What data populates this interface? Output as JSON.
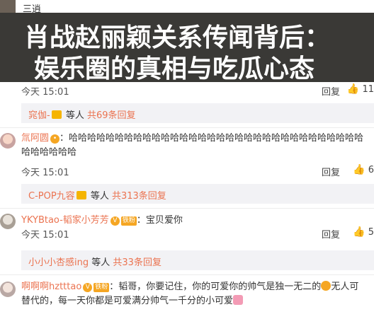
{
  "top_user": {
    "name": "三逍"
  },
  "banner": {
    "line1": "肖战赵丽颖关系传闻背后：",
    "line2": "娱乐圈的真相与吃瓜心态"
  },
  "row1": {
    "time": "今天 15:01",
    "reply": "回复",
    "like_count": "11"
  },
  "reply_box1": {
    "user": "窕伽-",
    "middle": "等人",
    "count": "共69条回复"
  },
  "comment2": {
    "user": "氚阿圆",
    "text_line1": "哈哈哈哈哈哈哈哈哈哈哈哈哈哈哈哈哈哈哈哈哈哈哈哈哈哈哈哈哈哈哈哈",
    "text_line2": "哈哈哈哈哈哈",
    "time": "今天 15:01",
    "reply": "回复",
    "like_count": "6"
  },
  "reply_box2": {
    "user": "C-POP九容",
    "middle": "等人",
    "count": "共313条回复"
  },
  "comment3": {
    "user": "YKYBtao-韬家小芳芳",
    "badge": "铁粉",
    "text": "：宝贝爱你",
    "time": "今天 15:01",
    "reply": "回复",
    "like_count": "5"
  },
  "reply_box3": {
    "user": "小小小杏感ing",
    "middle": "等人",
    "count": "共33条回复"
  },
  "comment4": {
    "user": "啊啊啊hztttao",
    "badge": "铁粉",
    "text_line1": "：韬哥，你要记住，你的可爱你的帅气是独一无二的",
    "text_line1_end": "无人可",
    "text_line2": "替代的，每一天你都是可爱满分帅气一千分的小可爱"
  },
  "colors": {
    "accent": "#eb7350",
    "reply_bg": "#f2f2f5",
    "banner_bg": "#3a3936"
  }
}
